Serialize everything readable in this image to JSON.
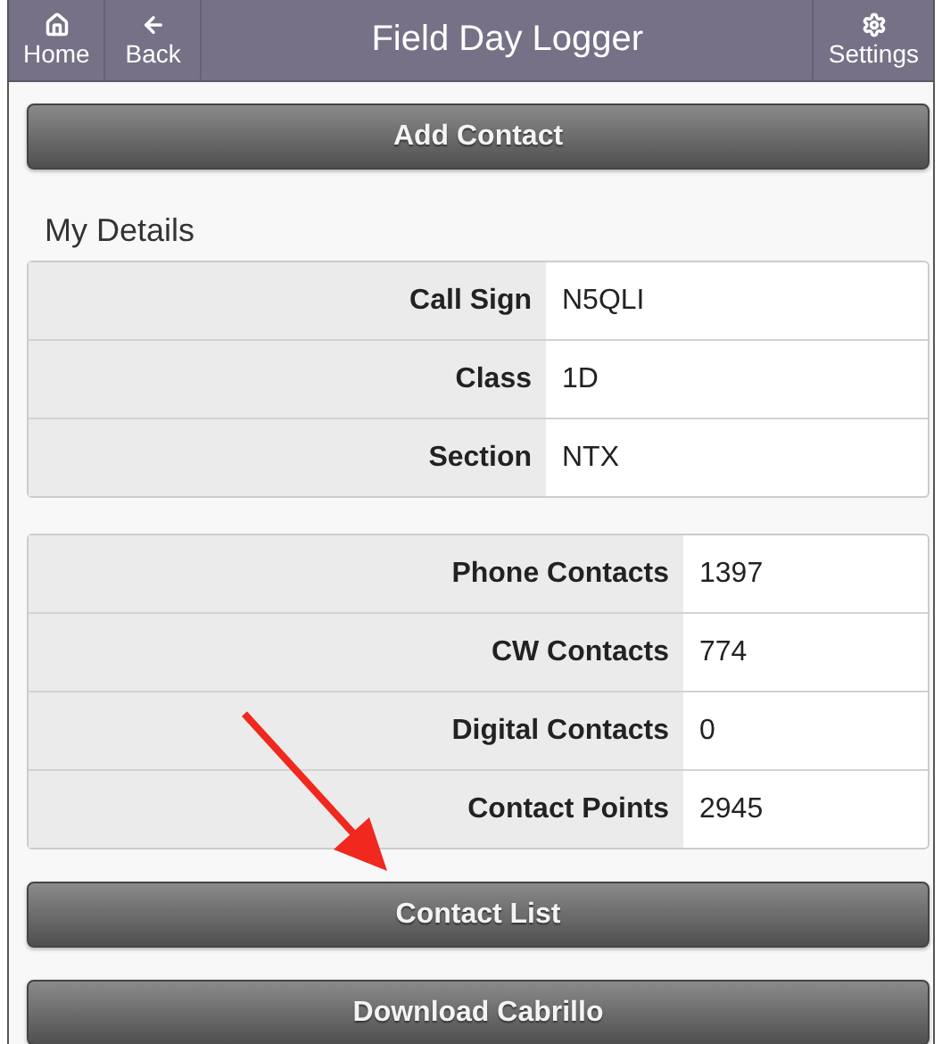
{
  "header": {
    "left_buttons": [
      {
        "label": "Home",
        "kind": "home"
      },
      {
        "label": "Back",
        "kind": "back"
      }
    ],
    "title": "Field Day Logger",
    "right_buttons": [
      {
        "label": "Settings",
        "kind": "settings"
      }
    ]
  },
  "top_button": "Add Contact",
  "my_details": {
    "title": "My Details",
    "rows": [
      {
        "label": "Call Sign",
        "value": "N5QLI"
      },
      {
        "label": "Class",
        "value": "1D"
      },
      {
        "label": "Section",
        "value": "NTX"
      }
    ]
  },
  "stats": {
    "rows": [
      {
        "label": "Phone Contacts",
        "value": "1397"
      },
      {
        "label": "CW Contacts",
        "value": "774"
      },
      {
        "label": "Digital Contacts",
        "value": "0"
      },
      {
        "label": "Contact Points",
        "value": "2945"
      }
    ]
  },
  "bottom_buttons": [
    "Contact List",
    "Download Cabrillo"
  ]
}
